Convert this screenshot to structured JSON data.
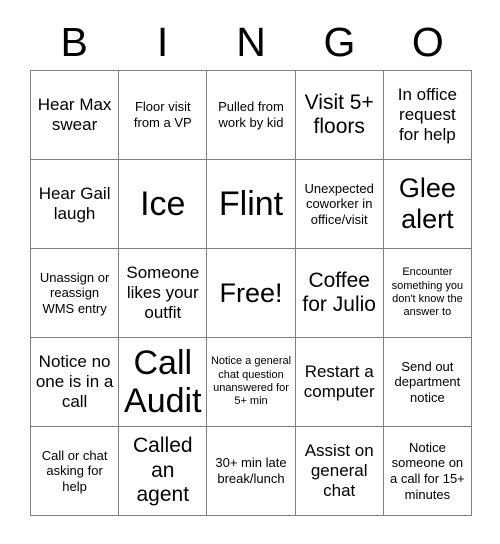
{
  "card": {
    "title": "BINGO",
    "free_space_index": 12,
    "colors": {
      "background": "#ffffff",
      "text": "#000000",
      "grid_line": "#808080"
    }
  },
  "header": {
    "letters": [
      "B",
      "I",
      "N",
      "G",
      "O"
    ]
  },
  "grid": {
    "columns": 5,
    "rows": 5,
    "cells": [
      {
        "text": "Hear Max swear",
        "size": "md",
        "free": false
      },
      {
        "text": "Floor visit from a VP",
        "size": "sm",
        "free": false
      },
      {
        "text": "Pulled from work by kid",
        "size": "sm",
        "free": false
      },
      {
        "text": "Visit 5+ floors",
        "size": "lg",
        "free": false
      },
      {
        "text": "In office request for help",
        "size": "md",
        "free": false
      },
      {
        "text": "Hear Gail laugh",
        "size": "md",
        "free": false
      },
      {
        "text": "Ice",
        "size": "xxl",
        "free": false
      },
      {
        "text": "Flint",
        "size": "xxl",
        "free": false
      },
      {
        "text": "Unexpected coworker in office/visit",
        "size": "sm",
        "free": false
      },
      {
        "text": "Glee alert",
        "size": "xl",
        "free": false
      },
      {
        "text": "Unassign or reassign WMS entry",
        "size": "sm",
        "free": false
      },
      {
        "text": "Someone likes your outfit",
        "size": "md",
        "free": false
      },
      {
        "text": "Free!",
        "size": "xl",
        "free": true
      },
      {
        "text": "Coffee for Julio",
        "size": "lg",
        "free": false
      },
      {
        "text": "Encounter something you don't know the answer to",
        "size": "xs",
        "free": false
      },
      {
        "text": "Notice no one is in a call",
        "size": "md",
        "free": false
      },
      {
        "text": "Call Audit",
        "size": "xxl",
        "free": false
      },
      {
        "text": "Notice a general chat question unanswered for 5+ min",
        "size": "xs",
        "free": false
      },
      {
        "text": "Restart a computer",
        "size": "md",
        "free": false
      },
      {
        "text": "Send out department notice",
        "size": "sm",
        "free": false
      },
      {
        "text": "Call or chat asking for help",
        "size": "sm",
        "free": false
      },
      {
        "text": "Called an agent",
        "size": "lg",
        "free": false
      },
      {
        "text": "30+ min late break/lunch",
        "size": "sm",
        "free": false
      },
      {
        "text": "Assist on general chat",
        "size": "md",
        "free": false
      },
      {
        "text": "Notice someone on a call for 15+ minutes",
        "size": "sm",
        "free": false
      }
    ]
  }
}
